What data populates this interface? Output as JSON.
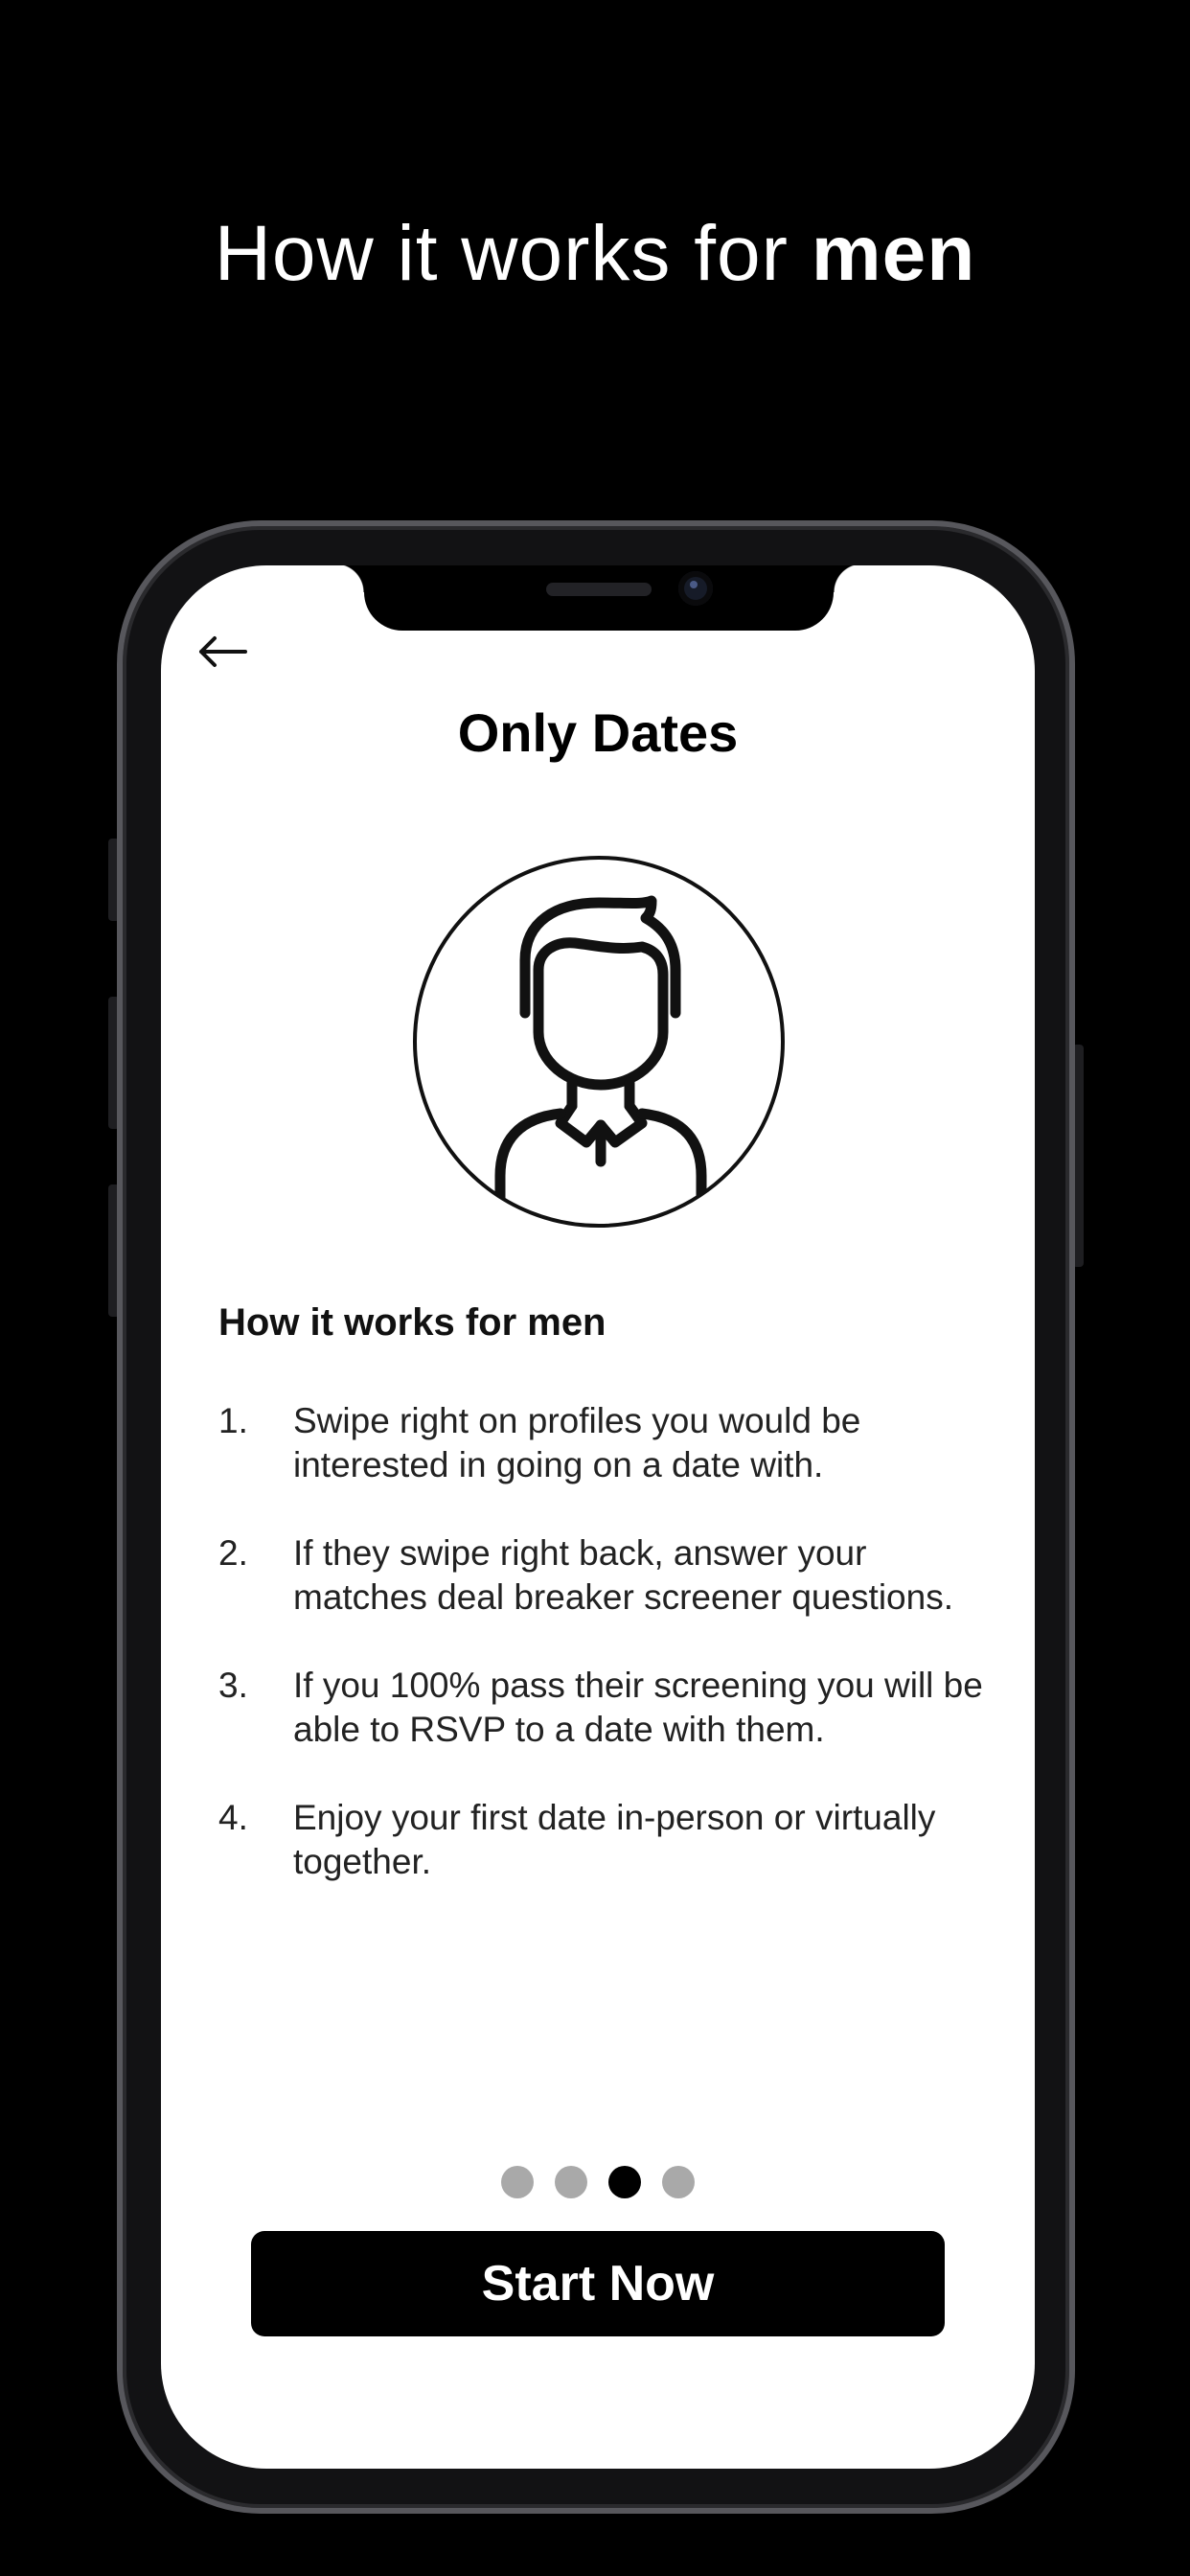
{
  "headline": {
    "prefix": "How it works for ",
    "emphasis": "men"
  },
  "app": {
    "back_icon": "arrow-left-icon",
    "title": "Only Dates",
    "avatar_icon": "man-avatar-icon"
  },
  "content": {
    "heading": "How it works for men",
    "steps": [
      {
        "number": "1.",
        "text": "Swipe right on profiles you would be interested in going on a date with."
      },
      {
        "number": "2.",
        "text": "If they swipe right back, answer your matches deal breaker screener questions."
      },
      {
        "number": "3.",
        "text": "If you 100% pass their screening you will be able to RSVP to a date with them."
      },
      {
        "number": "4.",
        "text": "Enjoy your first date in-person or virtually together."
      }
    ]
  },
  "pagination": {
    "total": 4,
    "active_index": 2
  },
  "cta": {
    "label": "Start Now"
  },
  "colors": {
    "background": "#000000",
    "screen": "#ffffff",
    "dot_inactive": "#a9a9a9",
    "dot_active": "#000000",
    "button": "#000000"
  }
}
